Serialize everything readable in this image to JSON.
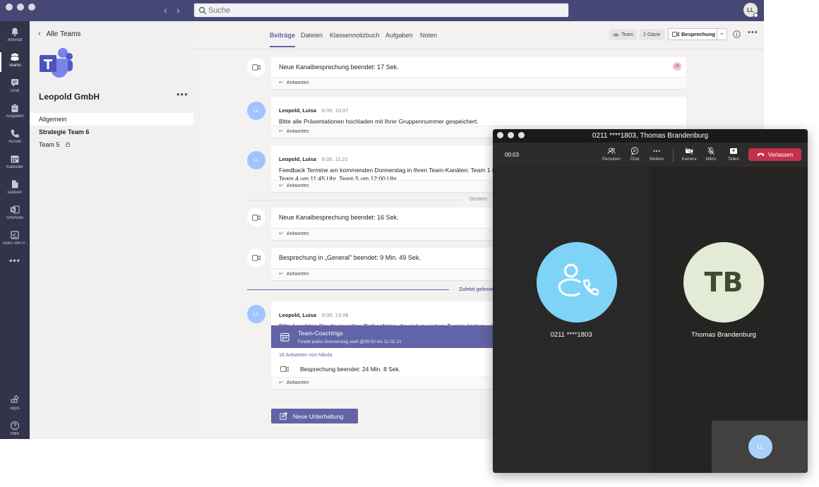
{
  "topbar": {
    "search_placeholder": "Suche",
    "user_initials": "LL"
  },
  "rail": {
    "items": [
      {
        "label": "Aktivität",
        "icon": "bell-icon"
      },
      {
        "label": "Teams",
        "icon": "teams-icon"
      },
      {
        "label": "Chat",
        "icon": "chat-icon"
      },
      {
        "label": "Aufgaben",
        "icon": "tasks-icon"
      },
      {
        "label": "Anrufe",
        "icon": "phone-icon"
      },
      {
        "label": "Kalender",
        "icon": "calendar-icon"
      },
      {
        "label": "Dateien",
        "icon": "files-icon"
      },
      {
        "label": "OneNote",
        "icon": "onenote-icon"
      },
      {
        "label": "Tasks von P...",
        "icon": "planner-icon"
      }
    ],
    "more": "•••",
    "apps_label": "Apps",
    "help_label": "Hilfe"
  },
  "sidebar": {
    "back_label": "Alle Teams",
    "team_name": "Leopold GmbH",
    "more": "•••",
    "channels": [
      {
        "label": "Allgemein"
      },
      {
        "label": "Strategie Team 6"
      },
      {
        "label": "Team 5"
      }
    ]
  },
  "tabs": {
    "items": [
      "Beiträge",
      "Dateien",
      "Klassennotizbuch",
      "Aufgaben",
      "Noten"
    ],
    "team_pill": "Team",
    "guests_pill": "2 Gäste",
    "meet_label": "Besprechung"
  },
  "feed": {
    "reply_label": "Antworten",
    "m1": {
      "text": "Neue Kanalbesprechung beendet: 17 Sek.",
      "badge": "JS"
    },
    "m2": {
      "author": "Leopold, Luisa",
      "time": "8.05. 10:07",
      "text": "Bitte alle Präsentationen hochladen mit Ihrer Gruppennummer gespeichert.",
      "initials": "LL"
    },
    "m3": {
      "author": "Leopold, Luisa",
      "time": "8.05. 11:21",
      "line1": "Feedback Termine am kommenden Donnerstag in Ihren Team-Kanälen: Team 1 um 10:15 Uhr, Team 2 um 10:45 Uhr, Team 3 um 11:15 Uhr,",
      "line2": "Team 4 um 11:45 Uhr, Team 5 um 12:00 Uhr",
      "initials": "LL"
    },
    "divider_yesterday": "Gestern",
    "m4": {
      "text": "Neue Kanalbesprechung beendet: 16 Sek."
    },
    "m5": {
      "text": "Besprechung in „General\" beendet: 9 Min. 49 Sek."
    },
    "divider_unread": "Zuletzt gelesen",
    "m6": {
      "author": "Leopold, Luisa",
      "time": "8.05. 13:08",
      "text": "Bitte beachten Sie die jeweilige Reihenfolge, die sich zu jedem Termin ändern wird.",
      "initials": "LL",
      "event_title": "Team-Coachings",
      "event_sub": "Findet jeden Donnerstag statt @09:00 bis 11.02.21",
      "replies": "16 Antworten von Nikola",
      "ended": "Besprechung beendet: 24 Min. 8 Sek."
    },
    "new_convo_label": "Neue Unterhaltung"
  },
  "call": {
    "title": "0211 ****1803, Thomas Brandenburg",
    "timer": "00:03",
    "toolbar": [
      "Personen",
      "Chat",
      "Weitere",
      "Kamera",
      "Mikro",
      "Teilen"
    ],
    "leave_label": "Verlassen",
    "left_name": "0211 ****1803",
    "right_initials": "TB",
    "right_name": "Thomas Brandenburg",
    "self_initials": "LL"
  },
  "colors": {
    "brand": "#6264a7",
    "titlebar": "#464775",
    "rail": "#33344a",
    "leave": "#c4314b"
  }
}
